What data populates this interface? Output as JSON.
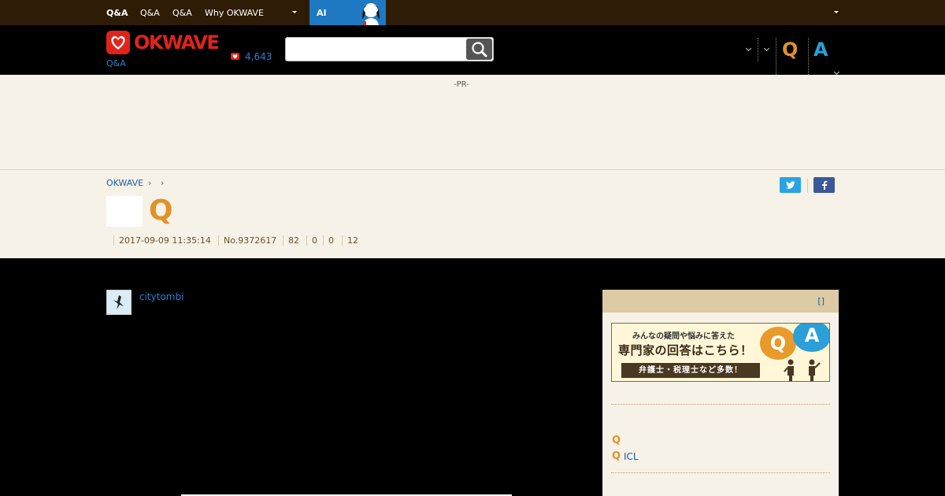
{
  "topnav": {
    "items": [
      "Q&A",
      "Q&A",
      "Q&A",
      "Why OKWAVE"
    ],
    "ai_label": "AI"
  },
  "header": {
    "logo_text": "OKWAVE",
    "logo_sub": "Q&A",
    "count": "4,643",
    "search_placeholder": "",
    "q_label": "Q",
    "a_label": "A"
  },
  "pr_label": "-PR-",
  "breadcrumb": {
    "home": "OKWAVE",
    "sep": "›"
  },
  "social": {
    "twitter": "t",
    "facebook": "f"
  },
  "question": {
    "q_mark": "Q",
    "meta": [
      "2017-09-09 11:35:14",
      "No.9372617",
      "82",
      "0",
      "0",
      "12"
    ]
  },
  "author": {
    "username": "citytombi"
  },
  "sidebar": {
    "header_link": "[]",
    "banner": {
      "line1": "みんなの疑問や悩みに答えた",
      "line2": "専門家の回答はこちら！",
      "ribbon": "弁護士・税理士など多数！",
      "q": "Q",
      "a": "A"
    },
    "related": [
      {
        "q": "Q",
        "text": ""
      },
      {
        "q": "Q",
        "text": "ICL"
      }
    ]
  },
  "colors": {
    "topnav_bg": "#2e1c06",
    "brand_red": "#e0241b",
    "q_orange": "#e0922a",
    "a_blue": "#2a9fd8",
    "link_blue": "#1a5fa8",
    "cream": "#f7f2e8"
  }
}
